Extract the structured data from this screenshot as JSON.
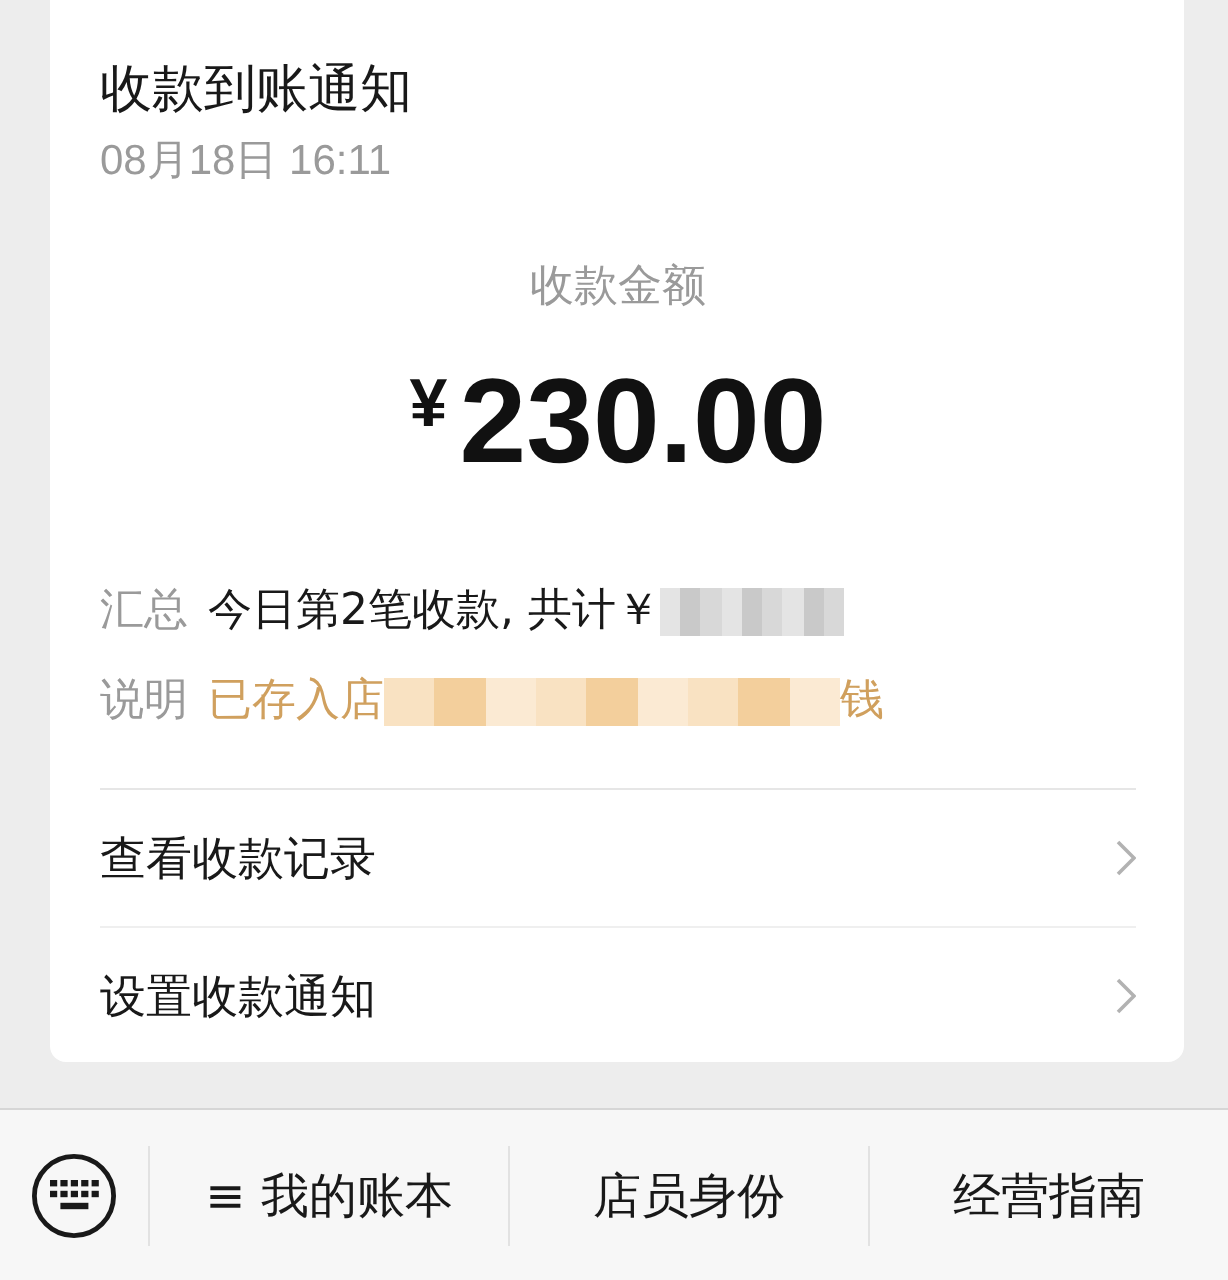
{
  "notification": {
    "title": "收款到账通知",
    "time": "08月18日 16:11"
  },
  "amount": {
    "label": "收款金额",
    "currency": "¥",
    "value": "230.00"
  },
  "details": [
    {
      "kind": "plain",
      "label": "汇总",
      "value_start": "今日第2笔收款, 共计￥",
      "redacted": true
    },
    {
      "kind": "accent",
      "label": "说明",
      "value_start": "已存入店",
      "redacted": true,
      "value_end": "钱"
    }
  ],
  "links": [
    {
      "label": "查看收款记录"
    },
    {
      "label": "设置收款通知"
    }
  ],
  "bottom_menu": [
    {
      "label": "≡ 我的账本"
    },
    {
      "label": "店员身份"
    },
    {
      "label": "经营指南"
    }
  ]
}
